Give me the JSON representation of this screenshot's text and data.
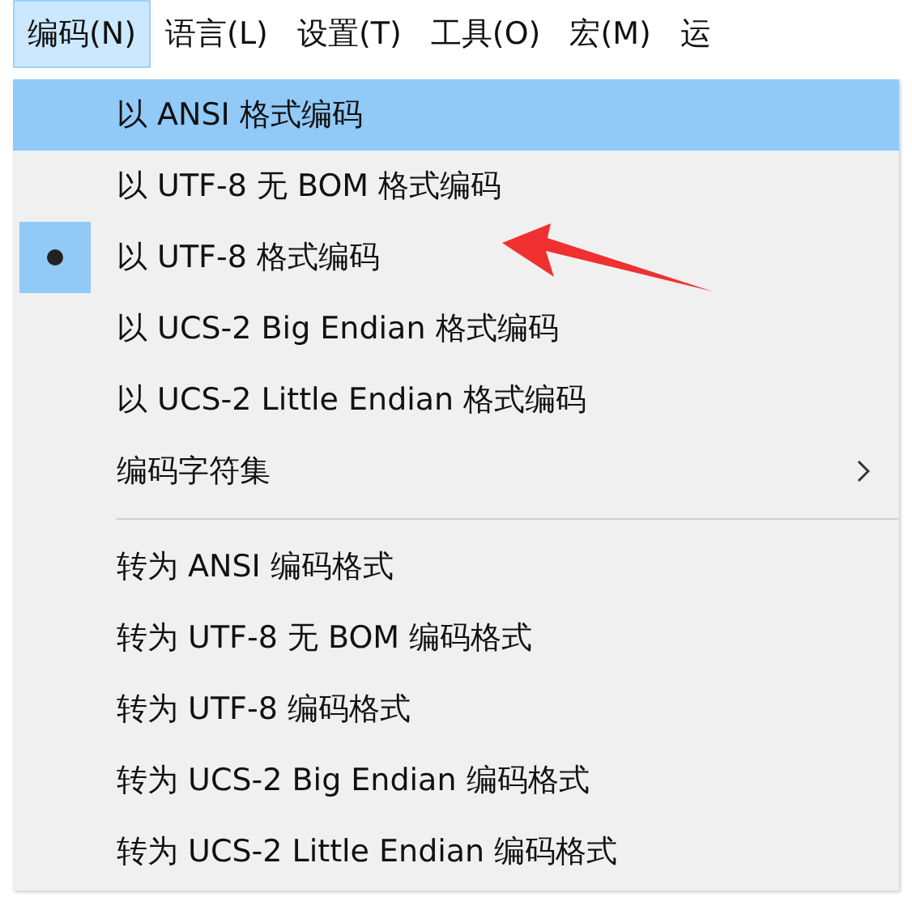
{
  "menubar": [
    {
      "label": "编码(N)",
      "selected": true
    },
    {
      "label": "语言(L)",
      "selected": false
    },
    {
      "label": "设置(T)",
      "selected": false
    },
    {
      "label": "工具(O)",
      "selected": false
    },
    {
      "label": "宏(M)",
      "selected": false
    },
    {
      "label": "运",
      "selected": false
    }
  ],
  "menu": {
    "groups": [
      [
        {
          "kind": "item",
          "label": "以 ANSI 格式编码",
          "highlighted": true,
          "checked": false
        },
        {
          "kind": "item",
          "label": "以 UTF-8 无 BOM 格式编码",
          "highlighted": false,
          "checked": false
        },
        {
          "kind": "item",
          "label": "以 UTF-8 格式编码",
          "highlighted": false,
          "checked": true
        },
        {
          "kind": "item",
          "label": "以 UCS-2 Big Endian 格式编码",
          "highlighted": false,
          "checked": false
        },
        {
          "kind": "item",
          "label": "以 UCS-2 Little Endian 格式编码",
          "highlighted": false,
          "checked": false
        },
        {
          "kind": "submenu",
          "label": "编码字符集",
          "highlighted": false,
          "checked": false
        }
      ],
      [
        {
          "kind": "item",
          "label": "转为 ANSI 编码格式",
          "highlighted": false,
          "checked": false
        },
        {
          "kind": "item",
          "label": "转为 UTF-8 无 BOM 编码格式",
          "highlighted": false,
          "checked": false
        },
        {
          "kind": "item",
          "label": "转为 UTF-8 编码格式",
          "highlighted": false,
          "checked": false
        },
        {
          "kind": "item",
          "label": "转为 UCS-2 Big Endian 编码格式",
          "highlighted": false,
          "checked": false
        },
        {
          "kind": "item",
          "label": "转为 UCS-2 Little Endian 编码格式",
          "highlighted": false,
          "checked": false
        }
      ]
    ]
  }
}
